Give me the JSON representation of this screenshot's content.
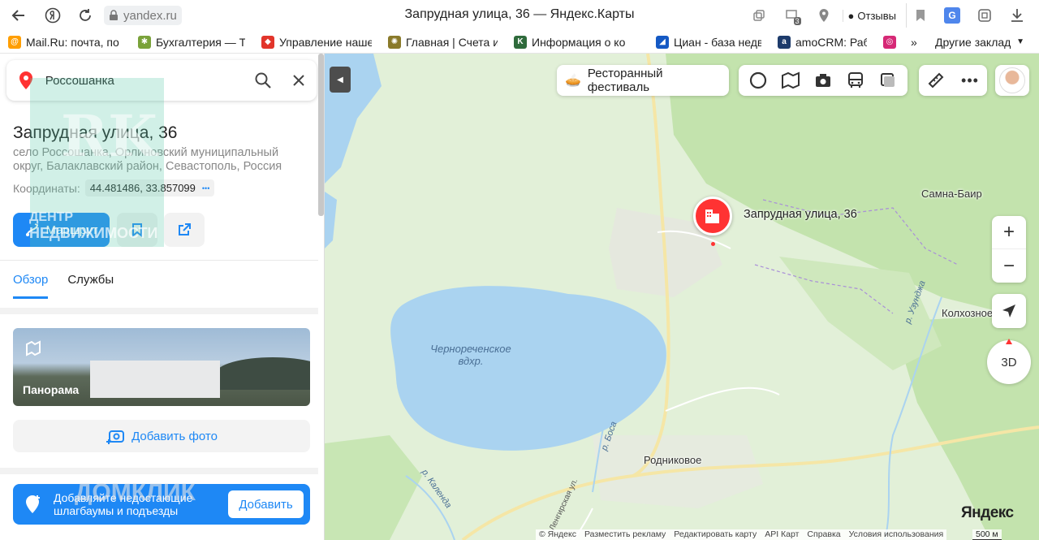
{
  "browser": {
    "url": "yandex.ru",
    "page_title": "Запрудная улица, 36 — Яндекс.Карты",
    "reviews_label": "Отзывы",
    "badge_count": "3"
  },
  "bookmarks": {
    "items": [
      {
        "label": "Mail.Ru: почта, по",
        "color": "#ff9e00"
      },
      {
        "label": "Бухгалтерия — Ти",
        "color": "#7aa23a"
      },
      {
        "label": "Управление наше",
        "color": "#e2352b"
      },
      {
        "label": "Главная | Счета и",
        "color": "#8a7a2a"
      },
      {
        "label": "Информация о ко",
        "color": "#2f6b3c"
      },
      {
        "label": "Циан - база недви",
        "color": "#1459c4"
      },
      {
        "label": "amoCRM: Раб",
        "color": "#1d3b6b"
      },
      {
        "label": "",
        "color": "#d62976"
      }
    ],
    "more": "»",
    "other_label": "Другие закладки"
  },
  "search": {
    "value": "Россошанка"
  },
  "place": {
    "title": "Запрудная улица, 36",
    "subtitle": "село Россошанка, Орлиновский муниципальный округ, Балаклавский район, Севастополь, Россия",
    "coords_label": "Координаты:",
    "coords_value": "44.481486, 33.857099",
    "coords_more": "•••",
    "route_label": "Маршрут"
  },
  "tabs": [
    {
      "label": "Обзор",
      "active": true
    },
    {
      "label": "Службы",
      "active": false
    }
  ],
  "panorama_label": "Панорама",
  "add_photo_label": "Добавить фото",
  "promo": {
    "text": "Добавляйте недостающие шлагбаумы и подъезды",
    "button": "Добавить"
  },
  "watermark": {
    "letters": "RK",
    "line1": "ДЕНТР",
    "line2": "НЕДВИЖИМОСТИ",
    "domclick": "ДОМКЛИК"
  },
  "map": {
    "festival_label": "Ресторанный фестиваль",
    "marker_label": "Запрудная улица, 36",
    "labels": {
      "samna_bair": "Самна-Баир",
      "kolkhoznoe": "Колхозное",
      "rodnikovoe": "Родниковое",
      "reservoir": "Чернореченское вдхр.",
      "r_uzundzha": "р. Узунджа",
      "r_bosa": "р. Боса",
      "r_kalenda": "р. Календа",
      "lengirskaya": "Ленгирская ул."
    },
    "btn_3d": "3D",
    "zoom_in": "+",
    "zoom_out": "−",
    "logo": "Яндекс",
    "footer": [
      "© Яндекс",
      "Разместить рекламу",
      "Редактировать карту",
      "API Карт",
      "Справка",
      "Условия использования"
    ],
    "scale": "500 м"
  },
  "colors": {
    "accent": "#1e88f5",
    "marker": "#ff3333",
    "water": "#aad3f0",
    "forest": "#c8e6b4"
  }
}
